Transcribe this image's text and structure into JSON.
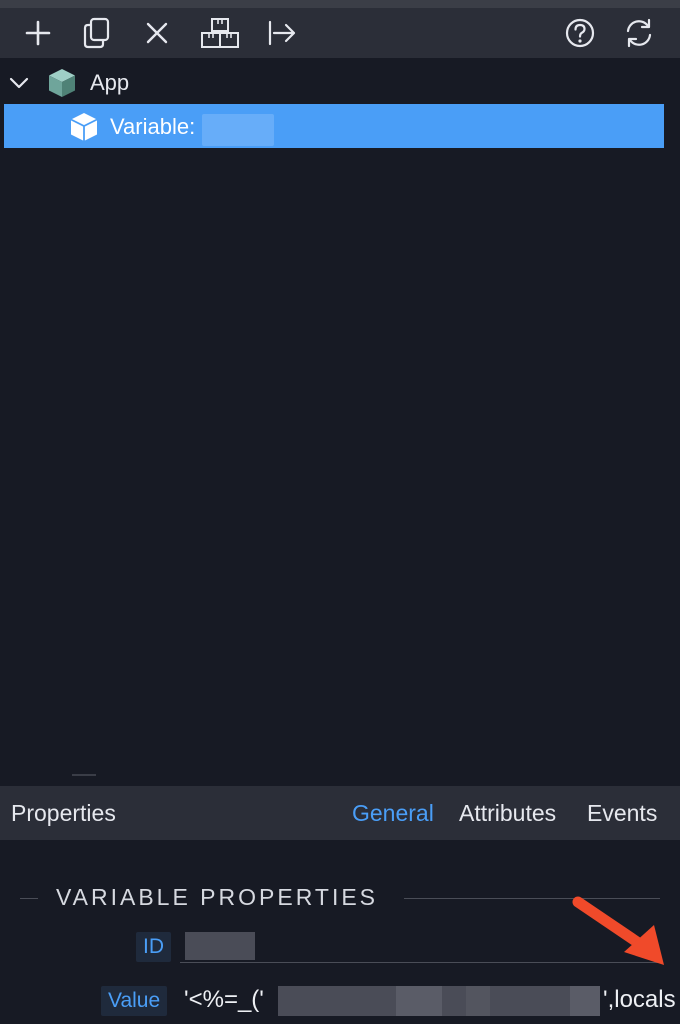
{
  "toolbar": {
    "buttons": [
      {
        "icon": "plus-icon"
      },
      {
        "icon": "copy-icon"
      },
      {
        "icon": "close-icon"
      },
      {
        "icon": "boxes-icon"
      },
      {
        "icon": "move-to-icon"
      },
      {
        "icon": "help-icon"
      },
      {
        "icon": "refresh-icon"
      }
    ]
  },
  "tree": {
    "root": {
      "label": "App",
      "icon": "box-icon",
      "expanded": true
    },
    "child": {
      "label": "Variable:",
      "icon": "box-icon",
      "selected": true
    }
  },
  "properties": {
    "title": "Properties",
    "tabs": {
      "general": "General",
      "attributes": "Attributes",
      "events": "Events"
    },
    "active_tab": "General",
    "section_title": "VARIABLE PROPERTIES",
    "id_label": "ID",
    "value_label": "Value",
    "value_prefix": "'<%=_('",
    "value_suffix": "',locals"
  },
  "colors": {
    "accent": "#4a9ef7",
    "background": "#171a24",
    "toolbar": "#2b2e38",
    "annotation_arrow": "#f04a2a"
  }
}
